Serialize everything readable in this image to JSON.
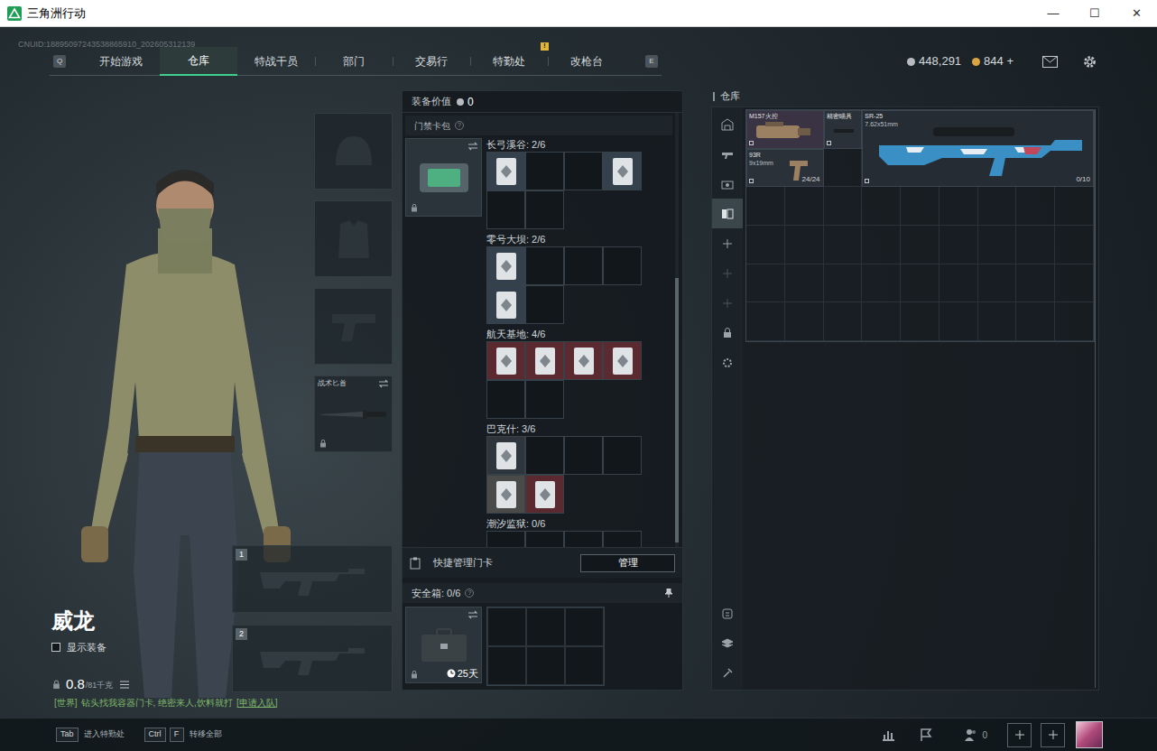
{
  "window": {
    "title": "三角洲行动",
    "controls": [
      "—",
      "☐",
      "✕"
    ]
  },
  "uid": "CNUID:18895097243538865910_202605312139",
  "nav": {
    "prev_key": "Q",
    "next_key": "E",
    "tabs": [
      {
        "label": "开始游戏",
        "selected": false
      },
      {
        "label": "仓库",
        "selected": true
      },
      {
        "label": "特战干员",
        "selected": false
      },
      {
        "label": "部门",
        "selected": false
      },
      {
        "label": "交易行",
        "selected": false
      },
      {
        "label": "特勤处",
        "selected": false,
        "badge": "!"
      },
      {
        "label": "改枪台",
        "selected": false
      }
    ]
  },
  "currencies": [
    {
      "amount": "448,291",
      "color": "#b8bcc0"
    },
    {
      "amount": "844 +",
      "color": "#d9a441"
    }
  ],
  "character": {
    "name": "威龙",
    "show_equipment": {
      "label": "显示装备",
      "checked": false
    },
    "weight": "0.8",
    "capacity": "/81千克"
  },
  "chat": {
    "channel": "[世界]",
    "message": "钻头找我容器门卡, 绝密来人,饮料就打",
    "action": "[申请入队]"
  },
  "equipment": [
    {
      "kind": "helmet"
    },
    {
      "kind": "armor"
    },
    {
      "kind": "pistol"
    },
    {
      "kind": "knife",
      "label": "战术匕首",
      "locked": true
    }
  ],
  "weapon_slots": [
    {
      "number": "1"
    },
    {
      "number": "2"
    }
  ],
  "loadout": {
    "value_label": "装备价值",
    "value": "0",
    "scrollbar": {
      "start": 0.38,
      "size": 0.61
    },
    "keycards": {
      "title": "门禁卡包",
      "help": "?",
      "locked": true,
      "maps": [
        {
          "label": "长弓溪谷: 2/6",
          "slots": [
            {
              "filled": true,
              "color": "#34414d"
            },
            {
              "filled": false
            },
            {
              "filled": false
            },
            {
              "filled": true,
              "color": "#34414d"
            },
            {
              "filled": false
            },
            {
              "filled": false
            }
          ]
        },
        {
          "label": "零号大坝: 2/6",
          "slots": [
            {
              "filled": true,
              "color": "#34414d"
            },
            {
              "filled": false
            },
            {
              "filled": false
            },
            {
              "filled": false
            },
            {
              "filled": true,
              "color": "#34414d"
            },
            {
              "filled": false
            }
          ]
        },
        {
          "label": "航天基地: 4/6",
          "slots": [
            {
              "filled": true,
              "color": "#5a2a30"
            },
            {
              "filled": true,
              "color": "#5a2a30"
            },
            {
              "filled": true,
              "color": "#5a2a30"
            },
            {
              "filled": true,
              "color": "#5a2a30"
            },
            {
              "filled": false
            },
            {
              "filled": false
            }
          ]
        },
        {
          "label": "巴克什: 3/6",
          "slots": [
            {
              "filled": true,
              "color": "#2e353c"
            },
            {
              "filled": false
            },
            {
              "filled": false
            },
            {
              "filled": false
            },
            {
              "filled": true,
              "color": "#4a4a48"
            },
            {
              "filled": true,
              "color": "#5a2a30"
            }
          ]
        },
        {
          "label": "潮汐监狱: 0/6",
          "slots": [
            {
              "filled": false
            },
            {
              "filled": false
            },
            {
              "filled": false
            },
            {
              "filled": false
            },
            {
              "filled": false
            },
            {
              "filled": false
            }
          ]
        }
      ]
    },
    "quick_manage": {
      "label": "快捷管理门卡",
      "button": "管理"
    },
    "safe_box": {
      "title": "安全箱: 0/6",
      "help": "?",
      "duration": "25天",
      "locked": true
    }
  },
  "warehouse": {
    "title": "仓库",
    "sidebar": [
      {
        "kind": "storage",
        "selected": false
      },
      {
        "kind": "weapons",
        "selected": false
      },
      {
        "kind": "camera",
        "selected": false
      },
      {
        "kind": "cards",
        "selected": true
      },
      {
        "kind": "add",
        "selected": false
      },
      {
        "kind": "add-dim",
        "selected": false
      },
      {
        "kind": "add-dim",
        "selected": false
      },
      {
        "kind": "lock",
        "selected": false
      },
      {
        "kind": "gear",
        "selected": false
      },
      {
        "kind": "sort",
        "selected": false
      },
      {
        "kind": "layers",
        "selected": false
      },
      {
        "kind": "tool",
        "selected": false
      }
    ],
    "items": [
      {
        "kind": "scope",
        "name": "M157火控",
        "color": "#3a3344"
      },
      {
        "kind": "attachment",
        "name": "精密瞄具",
        "color": "#2b3138"
      },
      {
        "kind": "rifle",
        "name": "SR-25",
        "caliber": "7.62x51mm",
        "count": "0/10",
        "color": "#262c33"
      },
      {
        "kind": "pistol",
        "name": "93R",
        "caliber": "9x19mm",
        "count": "24/24",
        "color": "#2b3138"
      }
    ]
  },
  "bottom_bar": {
    "hints": [
      {
        "keys": [
          "Tab"
        ],
        "label": "进入特勤处"
      },
      {
        "keys": [
          "Ctrl",
          "F"
        ],
        "label": "转移全部"
      }
    ],
    "friends": "0"
  }
}
